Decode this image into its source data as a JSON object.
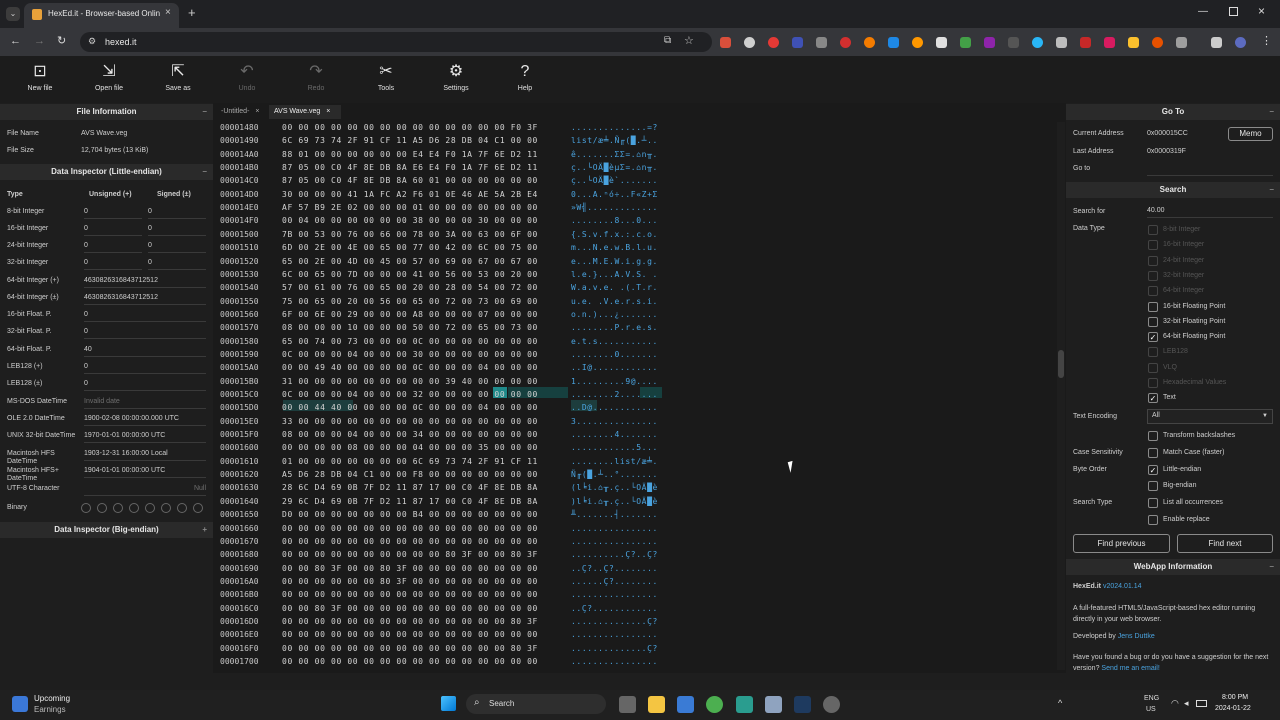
{
  "browser": {
    "tab_title": "HexEd.it - Browser-based Onlin",
    "url": "hexed.it"
  },
  "toolbar": {
    "new_file": "New file",
    "open_file": "Open file",
    "save_as": "Save as",
    "undo": "Undo",
    "redo": "Redo",
    "tools": "Tools",
    "settings": "Settings",
    "help": "Help"
  },
  "file_info": {
    "header": "File Information",
    "name_label": "File Name",
    "name": "AVS Wave.veg",
    "size_label": "File Size",
    "size": "12,704 bytes (13 KiB)"
  },
  "inspector_le": {
    "header": "Data Inspector (Little-endian)",
    "col_type": "Type",
    "col_unsigned": "Unsigned (+)",
    "col_signed": "Signed (±)",
    "rows": [
      {
        "label": "8-bit Integer",
        "u": "0",
        "s": "0"
      },
      {
        "label": "16-bit Integer",
        "u": "0",
        "s": "0"
      },
      {
        "label": "24-bit Integer",
        "u": "0",
        "s": "0"
      },
      {
        "label": "32-bit Integer",
        "u": "0",
        "s": "0"
      },
      {
        "label": "64-bit Integer (+)",
        "v": "4630826316843712512"
      },
      {
        "label": "64-bit Integer (±)",
        "v": "4630826316843712512"
      },
      {
        "label": "16-bit Float. P.",
        "v": "0"
      },
      {
        "label": "32-bit Float. P.",
        "v": "0"
      },
      {
        "label": "64-bit Float. P.",
        "v": "40"
      },
      {
        "label": "LEB128 (+)",
        "v": "0"
      },
      {
        "label": "LEB128 (±)",
        "v": "0"
      },
      {
        "label": "MS-DOS DateTime",
        "v": "Invalid date"
      },
      {
        "label": "OLE 2.0 DateTime",
        "v": "1900-02-08 00:00:00.000 UTC"
      },
      {
        "label": "UNIX 32-bit DateTime",
        "v": "1970-01-01 00:00:00 UTC"
      },
      {
        "label": "Macintosh HFS DateTime",
        "v": "1903-12-31 16:00:00 Local"
      },
      {
        "label": "Macintosh HFS+ DateTime",
        "v": "1904-01-01 00:00:00 UTC"
      },
      {
        "label": "UTF-8 Character",
        "v": "Null"
      },
      {
        "label": "Binary",
        "v": ""
      }
    ]
  },
  "inspector_be": {
    "header": "Data Inspector (Big-endian)"
  },
  "tabs": [
    {
      "label": "-Untitled-"
    },
    {
      "label": "AVS Wave.veg"
    }
  ],
  "hex_rows": [
    {
      "o": "00001480",
      "b": "00 00 00 00 00 00 00 00 00 00 00 00 00 00 F0 3F",
      "a": "..............=?"
    },
    {
      "o": "00001490",
      "b": "6C 69 73 74 2F 91 CF 11 A5 D6 28 DB 04 C1 00 00",
      "a": "list/æ╧.Ñ╓(█.┴.."
    },
    {
      "o": "000014A0",
      "b": "88 01 00 00 00 00 00 00 E4 E4 F0 1A 7F 6E D2 11",
      "a": "ê.......ΣΣ=.⌂n╥."
    },
    {
      "o": "000014B0",
      "b": "87 05 00 C0 4F 8E DB 8A E6 E4 F0 1A 7F 6E D2 11",
      "a": "ç..└OÄ█èµΣ=.⌂n╥."
    },
    {
      "o": "000014C0",
      "b": "87 05 00 C0 4F 8E DB 8A 60 01 00 00 00 00 00 00",
      "a": "ç..└OÄ█è`......."
    },
    {
      "o": "000014D0",
      "b": "30 00 00 00 41 1A FC A2 F6 01 0E 46 AE 5A 2B E4",
      "a": "0...A.ⁿó÷..F«Z+Σ"
    },
    {
      "o": "000014E0",
      "b": "AF 57 B9 2E 02 00 00 00 01 00 00 00 00 00 00 00",
      "a": "»W╣............."
    },
    {
      "o": "000014F0",
      "b": "00 04 00 00 00 00 00 00 38 00 00 00 30 00 00 00",
      "a": "........8...0..."
    },
    {
      "o": "00001500",
      "b": "7B 00 53 00 76 00 66 00 78 00 3A 00 63 00 6F 00",
      "a": "{.S.v.f.x.:.c.o."
    },
    {
      "o": "00001510",
      "b": "6D 00 2E 00 4E 00 65 00 77 00 42 00 6C 00 75 00",
      "a": "m...N.e.w.B.l.u."
    },
    {
      "o": "00001520",
      "b": "65 00 2E 00 4D 00 45 00 57 00 69 00 67 00 67 00",
      "a": "e...M.E.W.i.g.g."
    },
    {
      "o": "00001530",
      "b": "6C 00 65 00 7D 00 00 00 41 00 56 00 53 00 20 00",
      "a": "l.e.}...A.V.S. ."
    },
    {
      "o": "00001540",
      "b": "57 00 61 00 76 00 65 00 20 00 28 00 54 00 72 00",
      "a": "W.a.v.e. .(.T.r."
    },
    {
      "o": "00001550",
      "b": "75 00 65 00 20 00 56 00 65 00 72 00 73 00 69 00",
      "a": "u.e. .V.e.r.s.i."
    },
    {
      "o": "00001560",
      "b": "6F 00 6E 00 29 00 00 00 A8 00 00 00 07 00 00 00",
      "a": "o.n.)...¿......."
    },
    {
      "o": "00001570",
      "b": "08 00 00 00 10 00 00 00 50 00 72 00 65 00 73 00",
      "a": "........P.r.e.s."
    },
    {
      "o": "00001580",
      "b": "65 00 74 00 73 00 00 00 0C 00 00 00 00 00 00 00",
      "a": "e.t.s..........."
    },
    {
      "o": "00001590",
      "b": "0C 00 00 00 04 00 00 00 30 00 00 00 00 00 00 00",
      "a": "........0......."
    },
    {
      "o": "000015A0",
      "b": "00 00 49 40 00 00 00 00 0C 00 00 00 04 00 00 00",
      "a": "..I@............"
    },
    {
      "o": "000015B0",
      "b": "31 00 00 00 00 00 00 00 00 00 39 40 00 00 00 00",
      "a": "1.........9@...."
    },
    {
      "o": "000015C0",
      "b": "0C 00 00 00 04 00 00 00 32 00 00 00 00 00 00 00",
      "a": "........2......."
    },
    {
      "o": "000015D0",
      "b": "00 00 44 40 00 00 00 00 0C 00 00 00 04 00 00 00",
      "a": "..D@............"
    },
    {
      "o": "000015E0",
      "b": "33 00 00 00 00 00 00 00 00 00 00 00 00 00 00 00",
      "a": "3..............."
    },
    {
      "o": "000015F0",
      "b": "08 00 00 00 04 00 00 00 34 00 00 00 00 00 00 00",
      "a": "........4......."
    },
    {
      "o": "00001600",
      "b": "00 00 00 00 08 00 00 00 04 00 00 00 35 00 00 00",
      "a": "............5..."
    },
    {
      "o": "00001610",
      "b": "01 00 00 00 00 00 00 00 6C 69 73 74 2F 91 CF 11",
      "a": "........list/æ╧."
    },
    {
      "o": "00001620",
      "b": "A5 D6 28 DB 04 C1 00 00 F8 00 00 00 00 00 00 00",
      "a": "Ñ╓(█.┴..°......."
    },
    {
      "o": "00001630",
      "b": "28 6C D4 69 0B 7F D2 11 87 17 00 C0 4F 8E DB 8A",
      "a": "(l╘i.⌂╥.ç..└OÄ█è"
    },
    {
      "o": "00001640",
      "b": "29 6C D4 69 0B 7F D2 11 87 17 00 C0 4F 8E DB 8A",
      "a": ")l╘i.⌂╥.ç..└OÄ█è"
    },
    {
      "o": "00001650",
      "b": "D0 00 00 00 00 00 00 00 B4 00 00 00 00 00 00 00",
      "a": "╨.......┤......."
    },
    {
      "o": "00001660",
      "b": "00 00 00 00 00 00 00 00 00 00 00 00 00 00 00 00",
      "a": "................"
    },
    {
      "o": "00001670",
      "b": "00 00 00 00 00 00 00 00 00 00 00 00 00 00 00 00",
      "a": "................"
    },
    {
      "o": "00001680",
      "b": "00 00 00 00 00 00 00 00 00 00 80 3F 00 00 80 3F",
      "a": "..........Ç?..Ç?"
    },
    {
      "o": "00001690",
      "b": "00 00 80 3F 00 00 80 3F 00 00 00 00 00 00 00 00",
      "a": "..Ç?..Ç?........"
    },
    {
      "o": "000016A0",
      "b": "00 00 00 00 00 00 80 3F 00 00 00 00 00 00 00 00",
      "a": "......Ç?........"
    },
    {
      "o": "000016B0",
      "b": "00 00 00 00 00 00 00 00 00 00 00 00 00 00 00 00",
      "a": "................"
    },
    {
      "o": "000016C0",
      "b": "00 00 80 3F 00 00 00 00 00 00 00 00 00 00 00 00",
      "a": "..Ç?............"
    },
    {
      "o": "000016D0",
      "b": "00 00 00 00 00 00 00 00 00 00 00 00 00 00 80 3F",
      "a": "..............Ç?"
    },
    {
      "o": "000016E0",
      "b": "00 00 00 00 00 00 00 00 00 00 00 00 00 00 00 00",
      "a": "................"
    },
    {
      "o": "000016F0",
      "b": "00 00 00 00 00 00 00 00 00 00 00 00 00 00 80 3F",
      "a": "..............Ç?"
    },
    {
      "o": "00001700",
      "b": "00 00 00 00 00 00 00 00 00 00 00 00 00 00 00 00",
      "a": "................"
    }
  ],
  "goto": {
    "header": "Go To",
    "current_label": "Current Address",
    "current": "0x000015CC",
    "memo": "Memo",
    "last_label": "Last Address",
    "last": "0x0000319F",
    "goto_label": "Go to"
  },
  "search": {
    "header": "Search",
    "for_label": "Search for",
    "value": "40.00",
    "type_label": "Data Type",
    "types": [
      {
        "label": "8-bit Integer",
        "enabled": false,
        "checked": false
      },
      {
        "label": "16-bit Integer",
        "enabled": false,
        "checked": false
      },
      {
        "label": "24-bit Integer",
        "enabled": false,
        "checked": false
      },
      {
        "label": "32-bit Integer",
        "enabled": false,
        "checked": false
      },
      {
        "label": "64-bit Integer",
        "enabled": false,
        "checked": false
      },
      {
        "label": "16-bit Floating Point",
        "enabled": true,
        "checked": false
      },
      {
        "label": "32-bit Floating Point",
        "enabled": true,
        "checked": false
      },
      {
        "label": "64-bit Floating Point",
        "enabled": true,
        "checked": true
      },
      {
        "label": "LEB128",
        "enabled": false,
        "checked": false
      },
      {
        "label": "VLQ",
        "enabled": false,
        "checked": false
      },
      {
        "label": "Hexadecimal Values",
        "enabled": false,
        "checked": false
      },
      {
        "label": "Text",
        "enabled": true,
        "checked": true
      }
    ],
    "encoding_label": "Text Encoding",
    "encoding": "All",
    "transform": "Transform backslashes",
    "case_label": "Case Sensitivity",
    "match_case": "Match Case (faster)",
    "order_label": "Byte Order",
    "little": "Little-endian",
    "big": "Big-endian",
    "stype_label": "Search Type",
    "list_all": "List all occurrences",
    "enable_replace": "Enable replace",
    "find_prev": "Find previous",
    "find_next": "Find next"
  },
  "webapp": {
    "header": "WebApp Information",
    "name": "HexEd.it",
    "version": "v2024.01.14",
    "desc": "A full-featured HTML5/JavaScript-based hex editor running directly in your web browser.",
    "dev_label": "Developed by",
    "dev": "Jens Duttke",
    "bug": "Have you found a bug or do you have a suggestion for the next version?",
    "bug_link": "Send me an email!"
  },
  "taskbar": {
    "weather_title": "Upcoming",
    "weather_sub": "Earnings",
    "search": "Search",
    "lang1": "ENG",
    "lang2": "US",
    "time": "8:00 PM",
    "date": "2024-01-22"
  }
}
